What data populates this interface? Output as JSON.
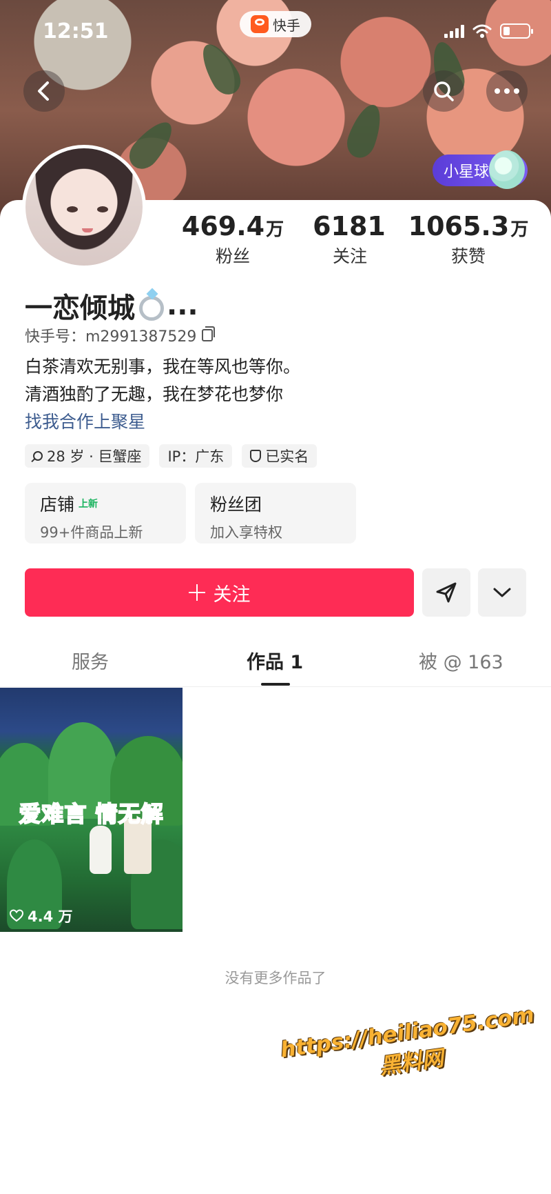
{
  "status_bar": {
    "time": "12:51",
    "app_name": "快手"
  },
  "header": {
    "badge_label": "小星球"
  },
  "profile": {
    "stats": [
      {
        "value": "469.4",
        "unit": "万",
        "label": "粉丝"
      },
      {
        "value": "6181",
        "unit": "",
        "label": "关注"
      },
      {
        "value": "1065.3",
        "unit": "万",
        "label": "获赞"
      }
    ],
    "nickname": "一恋倾城",
    "nickname_suffix": "...",
    "kuaishou_id": "快手号：m2991387529",
    "bio_lines": [
      "白茶清欢无别事，我在等风也等你。",
      "清酒独酌了无趣，我在梦花也梦你"
    ],
    "bio_link": "找我合作上聚星",
    "tags": [
      "28 岁 · 巨蟹座",
      "IP：广东",
      "已实名"
    ]
  },
  "entries": [
    {
      "title": "店铺",
      "badge": "上新",
      "subtitle": "99+件商品上新"
    },
    {
      "title": "粉丝团",
      "badge": "",
      "subtitle": "加入享特权"
    }
  ],
  "actions": {
    "follow_label": "关注"
  },
  "tabs": [
    {
      "label": "服务"
    },
    {
      "label": "作品 1"
    },
    {
      "label": "被 @ 163"
    }
  ],
  "posts": [
    {
      "caption": "爱难言 情无解",
      "likes": "4.4 万"
    }
  ],
  "no_more_text": "没有更多作品了",
  "watermark": {
    "line1": "https://heiliao75.com",
    "line2": "黑料网"
  },
  "colors": {
    "accent": "#fe2c55",
    "link": "#3d5c8f",
    "badge_green": "#19b35e",
    "planet_badge": "#5b3dd8"
  }
}
